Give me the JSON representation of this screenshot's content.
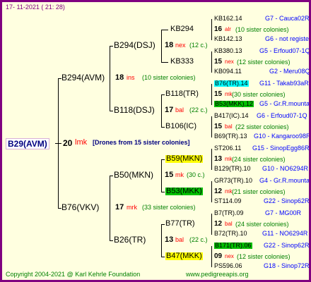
{
  "header": {
    "date": "17- 11-2021 ( 21: 28)"
  },
  "root": {
    "id": "B29(AVM)",
    "year": "20",
    "code": "lmk",
    "note": "[Drones from 15 sister colonies]"
  },
  "gen1": [
    {
      "id": "B294(AVM)",
      "year": "18",
      "code": "ins",
      "note": "(10 sister colonies)"
    },
    {
      "id": "B76(VKV)",
      "year": "17",
      "code": "mrk",
      "note": "(33 sister colonies)"
    }
  ],
  "gen2": [
    {
      "id": "B294(DSJ)",
      "year": "18",
      "code": "nex",
      "note": "(12 c.)"
    },
    {
      "id": "B118(DSJ)",
      "year": "17",
      "code": "bal",
      "note": "(22 c.)"
    },
    {
      "id": "B50(MKN)",
      "year": "15",
      "code": "mk",
      "note": "(30 c.)"
    },
    {
      "id": "B26(TR)",
      "year": "13",
      "code": "bal",
      "note": "(22 c.)"
    }
  ],
  "gen3": [
    {
      "id": "KB294"
    },
    {
      "id": "KB333"
    },
    {
      "id": "B118(TR)"
    },
    {
      "id": "B106(IC)"
    },
    {
      "id": "B59(MKN)"
    },
    {
      "id": "B53(MKK)"
    },
    {
      "id": "B77(TR)"
    },
    {
      "id": "B47(MKK)"
    }
  ],
  "gen4": [
    {
      "id": "KB162.14",
      "ref": "G7 - Cauca02R"
    },
    {
      "year": "16",
      "code": "alr",
      "note": "(10 sister colonies)"
    },
    {
      "id": "KB142.13",
      "ref": "G6 - not registe"
    },
    {
      "id": "KB380.13",
      "ref": "G5 - Erfoud07-1Q"
    },
    {
      "year": "15",
      "code": "nex",
      "note": "(12 sister colonies)"
    },
    {
      "id": "KB094.11",
      "ref": "G2 - Meru08Q"
    },
    {
      "id": "B76(TR).14",
      "ref": "G11 - Takab93aR"
    },
    {
      "year": "15",
      "code": "mk",
      "note": "(30 sister colonies)"
    },
    {
      "id": "B53(MKK).12",
      "ref": "G5 - Gr.R.mounta"
    },
    {
      "id": "B417(IC).14",
      "ref": "G6 - Erfoud07-1Q"
    },
    {
      "year": "15",
      "code": "bal",
      "note": "(22 sister colonies)"
    },
    {
      "id": "B69(TR).13",
      "ref": "G10 - Kangaroo98R"
    },
    {
      "id": "ST206.11",
      "ref": "G15 - SinopEgg86R"
    },
    {
      "year": "13",
      "code": "mk",
      "note": "(24 sister colonies)"
    },
    {
      "id": "B129(TR).10",
      "ref": "G10 - NO6294R"
    },
    {
      "id": "GR73(TR).10",
      "ref": "G4 - Gr.R.mounta"
    },
    {
      "year": "12",
      "code": "mk",
      "note": "(21 sister colonies)"
    },
    {
      "id": "ST114.09",
      "ref": "G22 - Sinop62R"
    },
    {
      "id": "B7(TR).09",
      "ref": "G7 - MG00R"
    },
    {
      "year": "12",
      "code": "bal",
      "note": "(24 sister colonies)"
    },
    {
      "id": "B72(TR).10",
      "ref": "G11 - NO6294R"
    },
    {
      "id": "B171(TR).06",
      "ref": "G22 - Sinop62R"
    },
    {
      "year": "09",
      "code": "nex",
      "note": "(12 sister colonies)"
    },
    {
      "id": "PS596.06",
      "ref": "G18 - Sinop72R"
    }
  ],
  "footer": {
    "copyright": "Copyright 2004-2021 @ Karl Kehrle Foundation",
    "site": "www.pedigreeapis.org"
  },
  "colors": {
    "frame": "#800080",
    "background": "#ffffe0",
    "code": "#ff0000",
    "sister": "#008000",
    "ref": "#0000ff",
    "yellow": "#ffff00",
    "green": "#00c000",
    "cyan": "#00ffff"
  }
}
